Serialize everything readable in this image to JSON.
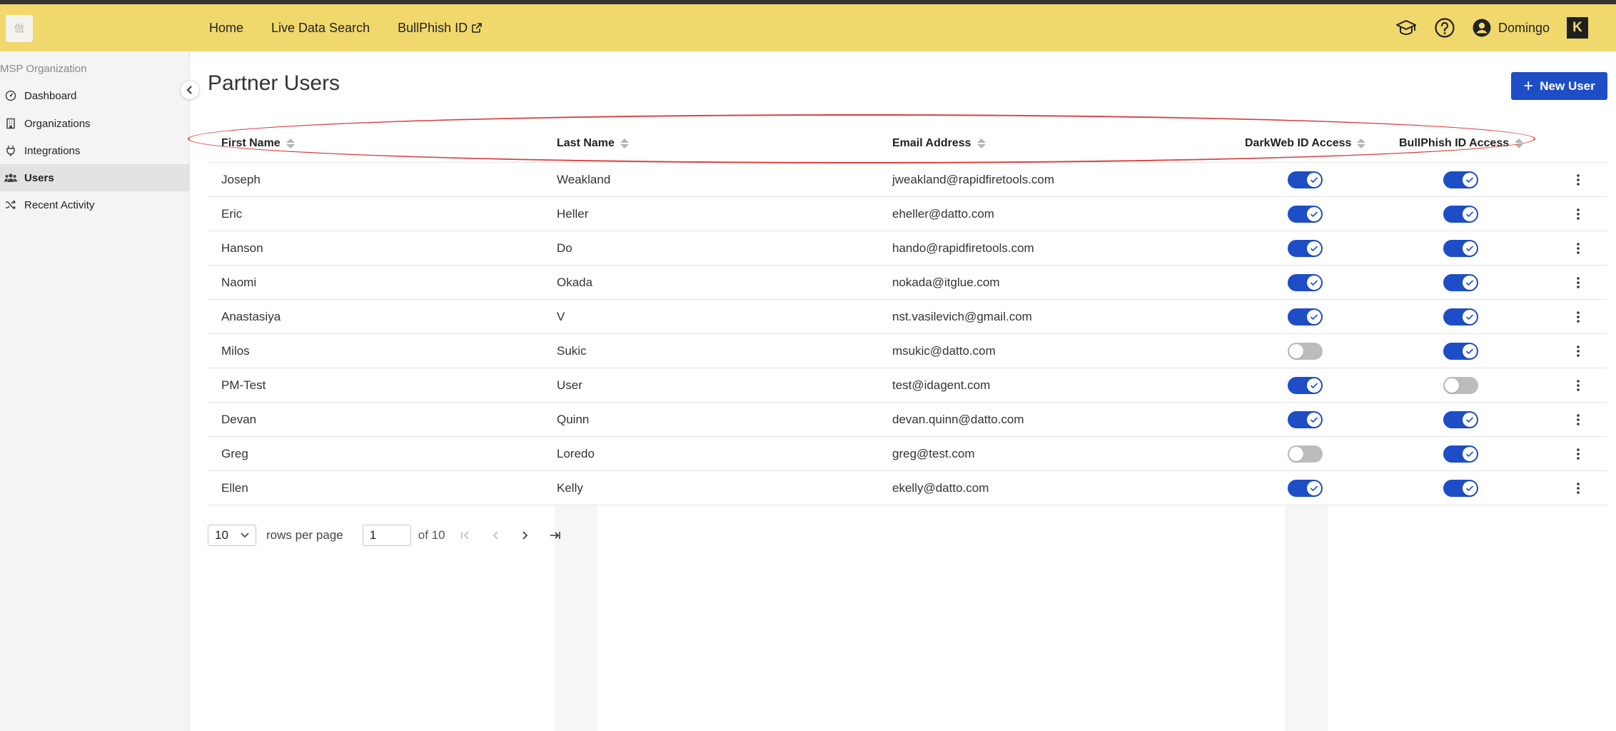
{
  "header": {
    "logo_text": "倣",
    "nav": [
      {
        "label": "Home"
      },
      {
        "label": "Live Data Search"
      },
      {
        "label": "BullPhish ID"
      }
    ],
    "user_name": "Domingo",
    "brand_logo": "K"
  },
  "sidebar": {
    "title": "MSP Organization",
    "items": [
      {
        "label": "Dashboard",
        "icon": "dashboard-icon"
      },
      {
        "label": "Organizations",
        "icon": "building-icon"
      },
      {
        "label": "Integrations",
        "icon": "plug-icon"
      },
      {
        "label": "Users",
        "icon": "users-icon",
        "active": true
      },
      {
        "label": "Recent Activity",
        "icon": "shuffle-icon"
      }
    ]
  },
  "page": {
    "title": "Partner Users",
    "new_user_label": "New User"
  },
  "table": {
    "columns": [
      "First Name",
      "Last Name",
      "Email Address",
      "DarkWeb ID Access",
      "BullPhish ID Access"
    ],
    "rows": [
      {
        "first": "Joseph",
        "last": "Weakland",
        "email": "jweakland@rapidfiretools.com",
        "darkweb": true,
        "bullphish": true
      },
      {
        "first": "Eric",
        "last": "Heller",
        "email": "eheller@datto.com",
        "darkweb": true,
        "bullphish": true
      },
      {
        "first": "Hanson",
        "last": "Do",
        "email": "hando@rapidfiretools.com",
        "darkweb": true,
        "bullphish": true
      },
      {
        "first": "Naomi",
        "last": "Okada",
        "email": "nokada@itglue.com",
        "darkweb": true,
        "bullphish": true
      },
      {
        "first": "Anastasiya",
        "last": "V",
        "email": "nst.vasilevich@gmail.com",
        "darkweb": true,
        "bullphish": true
      },
      {
        "first": "Milos",
        "last": "Sukic",
        "email": "msukic@datto.com",
        "darkweb": false,
        "bullphish": true
      },
      {
        "first": "PM-Test",
        "last": "User",
        "email": "test@idagent.com",
        "darkweb": true,
        "bullphish": false
      },
      {
        "first": "Devan",
        "last": "Quinn",
        "email": "devan.quinn@datto.com",
        "darkweb": true,
        "bullphish": true
      },
      {
        "first": "Greg",
        "last": "Loredo",
        "email": "greg@test.com",
        "darkweb": false,
        "bullphish": true
      },
      {
        "first": "Ellen",
        "last": "Kelly",
        "email": "ekelly@datto.com",
        "darkweb": true,
        "bullphish": true
      }
    ]
  },
  "pagination": {
    "rows_per_page_value": "10",
    "rows_per_page_label": "rows per page",
    "page_value": "1",
    "of_label": "of 10"
  },
  "colors": {
    "topbar": "#f0d86c",
    "accent": "#1e4ec6",
    "toggle_off": "#bcbcbc",
    "highlight": "#d94040"
  }
}
